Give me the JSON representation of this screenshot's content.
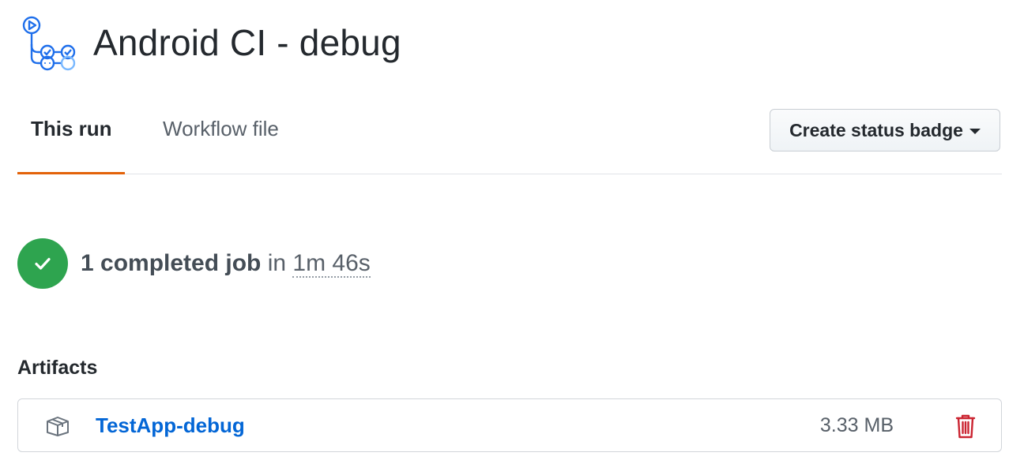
{
  "workflow": {
    "title": "Android CI - debug",
    "icon": "workflow-icon"
  },
  "tabs": [
    {
      "label": "This run",
      "active": true
    },
    {
      "label": "Workflow file",
      "active": false
    }
  ],
  "toolbar": {
    "status_badge_label": "Create status badge",
    "status_badge_icon": "caret-down-icon"
  },
  "summary": {
    "status": "success",
    "count_text": "1 completed job",
    "connector": "in",
    "duration": "1m 46s"
  },
  "artifacts": {
    "heading": "Artifacts",
    "items": [
      {
        "name": "TestApp-debug",
        "size": "3.33 MB",
        "icon": "package-icon",
        "delete_icon": "trash-icon"
      }
    ]
  },
  "colors": {
    "accent_tab": "#e36209",
    "success": "#2ea44f",
    "link": "#0366d6",
    "danger": "#cb2431",
    "workflow_icon": "#1f6feb"
  }
}
